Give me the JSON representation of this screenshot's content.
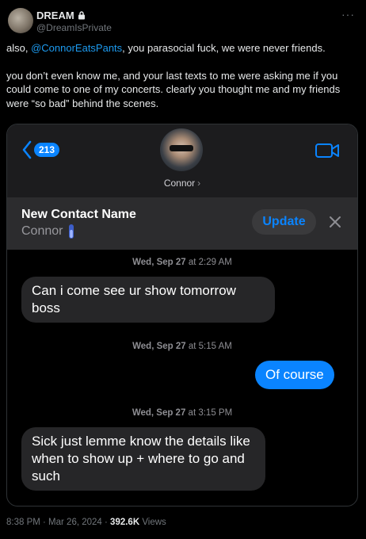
{
  "tweet": {
    "display_name": "DREAM",
    "handle": "@DreamIsPrivate",
    "more_label": "···",
    "para1_pre": "also, ",
    "mention": "@ConnorEatsPants",
    "para1_post": ", you parasocial fuck, we were never friends.",
    "para2": "you don’t even know me, and your last texts to me were asking me if you could come to one of my concerts. clearly you thought me and my friends were “so bad” behind the scenes."
  },
  "screenshot": {
    "back_count": "213",
    "contact_name": "Connor",
    "contact_chevron": "›",
    "banner_title": "New Contact Name",
    "banner_subtitle": "Connor",
    "update_label": "Update",
    "messages": [
      {
        "timestamp_day": "Wed, Sep 27",
        "timestamp_time": " at 2:29 AM",
        "text": "Can i come see ur show tomorrow boss",
        "from": "in"
      },
      {
        "timestamp_day": "Wed, Sep 27",
        "timestamp_time": " at 5:15 AM",
        "text": "Of course",
        "from": "out"
      },
      {
        "timestamp_day": "Wed, Sep 27",
        "timestamp_time": " at 3:15 PM",
        "text": "Sick just lemme know the details like when to show up + where to go and such",
        "from": "in"
      }
    ]
  },
  "footer": {
    "time_date": "8:38 PM · Mar 26, 2024 · ",
    "views_count": "392.6K",
    "views_label": " Views"
  },
  "colors": {
    "accent_blue": "#0a84ff",
    "link_blue": "#1d9bf0",
    "incoming_bubble": "#262628"
  }
}
